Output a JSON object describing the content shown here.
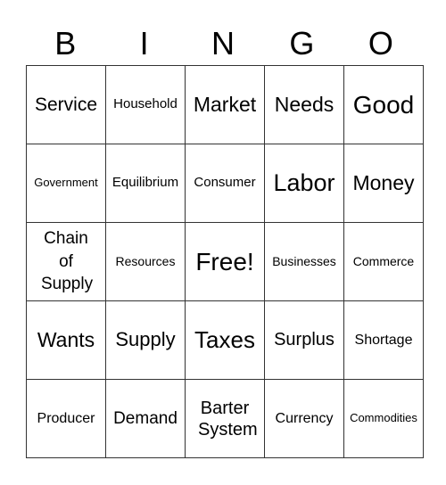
{
  "header": [
    "B",
    "I",
    "N",
    "G",
    "O"
  ],
  "cells": [
    [
      "Service",
      "Household",
      "Market",
      "Needs",
      "Good"
    ],
    [
      "Government",
      "Equilibrium",
      "Consumer",
      "Labor",
      "Money"
    ],
    [
      "Chain of Supply",
      "Resources",
      "Free!",
      "Businesses",
      "Commerce"
    ],
    [
      "Wants",
      "Supply",
      "Taxes",
      "Surplus",
      "Shortage"
    ],
    [
      "Producer",
      "Demand",
      "Barter System",
      "Currency",
      "Commodities"
    ]
  ]
}
